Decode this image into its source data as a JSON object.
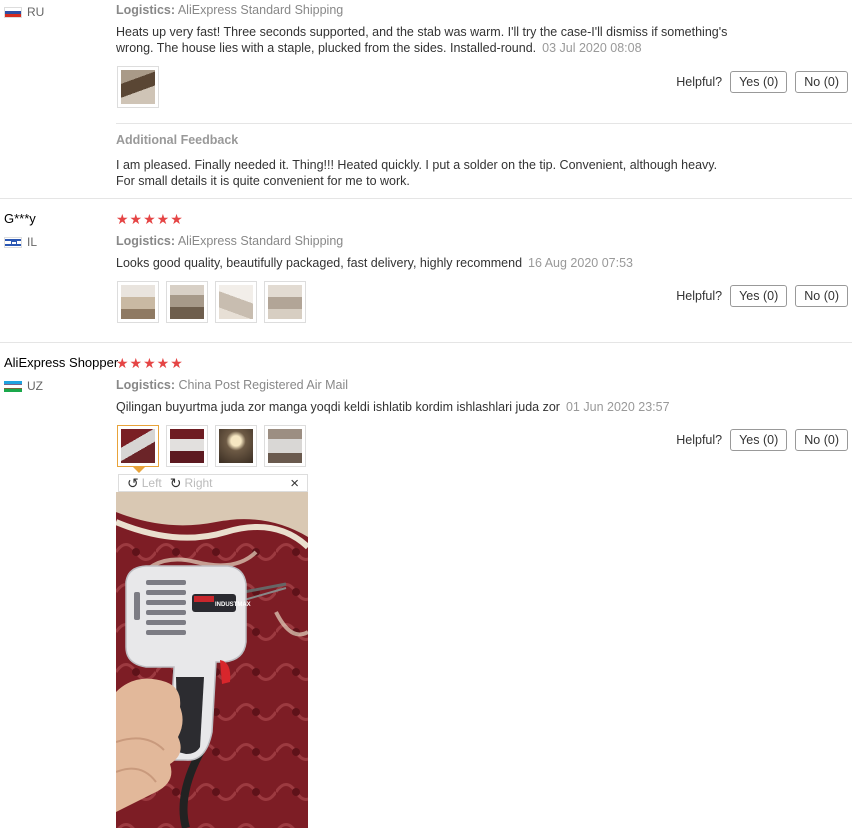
{
  "reviews": [
    {
      "name": "",
      "country": "RU",
      "logistics_label": "Logistics:",
      "logistics": "AliExpress Standard Shipping",
      "text_line1": "Heats up very fast! Three seconds supported, and the stab was warm. I'll try the case-I'll dismiss if something's",
      "text_line2": "wrong. The house lies with a staple, plucked from the sides. Installed-round.",
      "date": "03 Jul 2020 08:08",
      "helpful_label": "Helpful?",
      "yes_label": "Yes (0)",
      "no_label": "No (0)",
      "additional_feedback_title": "Additional Feedback",
      "additional_line1": "I am pleased. Finally needed it. Thing!!! Heated quickly. I put a solder on the tip. Convenient, although heavy.",
      "additional_line2": "For small details it is quite convenient for me to work."
    },
    {
      "name": "G***y",
      "country": "IL",
      "rating": "★★★★★",
      "logistics_label": "Logistics:",
      "logistics": "AliExpress Standard Shipping",
      "text": "Looks good quality, beautifully packaged, fast delivery, highly recommend",
      "date": "16 Aug 2020 07:53",
      "helpful_label": "Helpful?",
      "yes_label": "Yes (0)",
      "no_label": "No (0)"
    },
    {
      "name": "AliExpress Shopper",
      "country": "UZ",
      "rating": "★★★★★",
      "logistics_label": "Logistics:",
      "logistics": "China Post Registered Air Mail",
      "text": "Qilingan buyurtma juda zor manga yoqdi keldi ishlatib kordim ishlashlari juda zor",
      "date": "01 Jun 2020 23:57",
      "helpful_label": "Helpful?",
      "yes_label": "Yes (0)",
      "no_label": "No (0)"
    }
  ],
  "viewer": {
    "rotate_left_label": "Left",
    "rotate_right_label": "Right",
    "close_label": "×",
    "device_brand": "INDUSTMAX"
  },
  "colors": {
    "star": "#e54545",
    "active_thumb_border": "#e8a33a"
  }
}
